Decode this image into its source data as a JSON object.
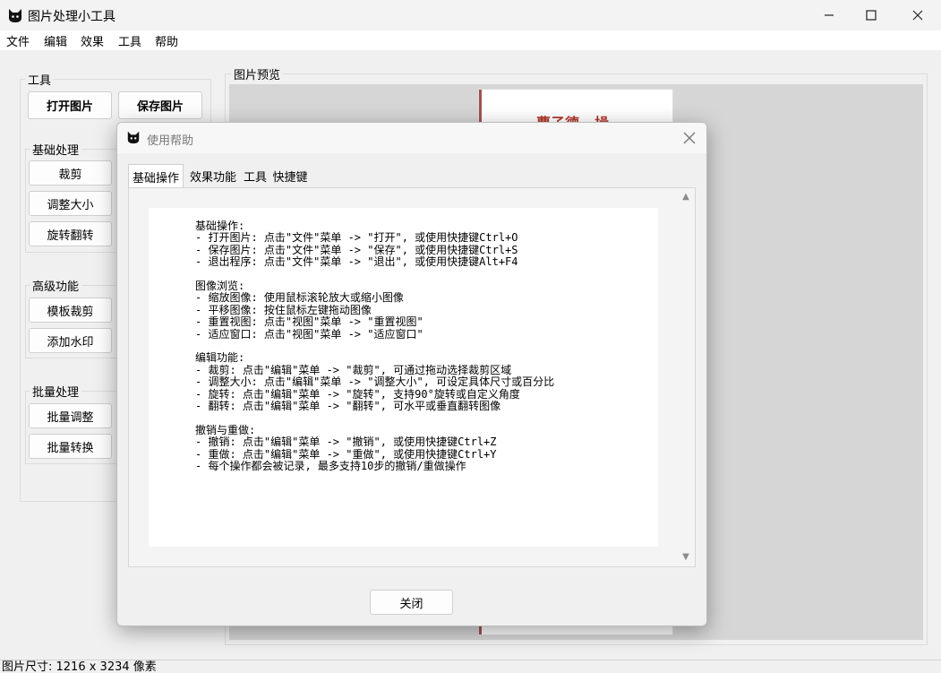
{
  "window": {
    "title": "图片处理小工具"
  },
  "menu": [
    "文件",
    "编辑",
    "效果",
    "工具",
    "帮助"
  ],
  "tools": {
    "title": "工具",
    "open_label": "打开图片",
    "save_label": "保存图片",
    "basic": {
      "title": "基础处理",
      "items": [
        "裁剪",
        "调整大小",
        "旋转翻转"
      ]
    },
    "advanced": {
      "title": "高级功能",
      "items": [
        "模板裁剪",
        "添加水印"
      ]
    },
    "batch": {
      "title": "批量处理",
      "items": [
        "批量调整",
        "批量转换"
      ]
    }
  },
  "preview": {
    "title": "图片预览",
    "doc_heading": "曹子德 · 操"
  },
  "status": {
    "text": "图片尺寸: 1216 x 3234 像素"
  },
  "dialog": {
    "title": "使用帮助",
    "tabs": [
      "基础操作",
      "效果功能",
      "工具",
      "快捷键"
    ],
    "active_tab": "基础操作",
    "content": "基础操作:\n- 打开图片: 点击\"文件\"菜单 -> \"打开\", 或使用快捷键Ctrl+O\n- 保存图片: 点击\"文件\"菜单 -> \"保存\", 或使用快捷键Ctrl+S\n- 退出程序: 点击\"文件\"菜单 -> \"退出\", 或使用快捷键Alt+F4\n\n图像浏览:\n- 缩放图像: 使用鼠标滚轮放大或缩小图像\n- 平移图像: 按住鼠标左键拖动图像\n- 重置视图: 点击\"视图\"菜单 -> \"重置视图\"\n- 适应窗口: 点击\"视图\"菜单 -> \"适应窗口\"\n\n编辑功能:\n- 裁剪: 点击\"编辑\"菜单 -> \"裁剪\", 可通过拖动选择裁剪区域\n- 调整大小: 点击\"编辑\"菜单 -> \"调整大小\", 可设定具体尺寸或百分比\n- 旋转: 点击\"编辑\"菜单 -> \"旋转\", 支持90°旋转或自定义角度\n- 翻转: 点击\"编辑\"菜单 -> \"翻转\", 可水平或垂直翻转图像\n\n撤销与重做:\n- 撤销: 点击\"编辑\"菜单 -> \"撤销\", 或使用快捷键Ctrl+Z\n- 重做: 点击\"编辑\"菜单 -> \"重做\", 或使用快捷键Ctrl+Y\n- 每个操作都会被记录, 最多支持10步的撤销/重做操作",
    "close_label": "关闭"
  },
  "colors": {
    "accent_doc": "#b03a2e",
    "preview_bg": "#d6d6d6"
  }
}
